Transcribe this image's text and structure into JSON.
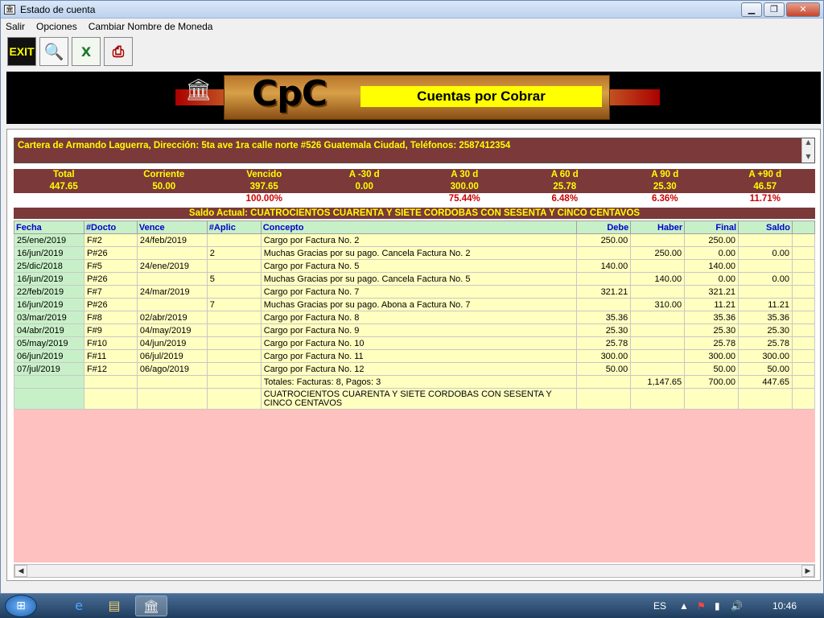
{
  "window": {
    "title": "Estado de cuenta"
  },
  "window_controls": {
    "minimize": "▁",
    "maximize": "❐",
    "close": "✕"
  },
  "menu": [
    "Salir",
    "Opciones",
    "Cambiar Nombre de Moneda"
  ],
  "toolbar": {
    "exit_label": "EXIT",
    "icons": [
      "exit-icon",
      "search-report-icon",
      "excel-icon",
      "print-icon"
    ]
  },
  "banner": {
    "logo": "CpC",
    "subtitle": "Cuentas por Cobrar"
  },
  "cartera": "Cartera de Armando Laguerra, Dirección: 5ta ave 1ra calle norte #526 Guatemala Ciudad, Teléfonos: 2587412354",
  "summary": {
    "headers": [
      "Total",
      "Corriente",
      "Vencido",
      "A -30 d",
      "A 30 d",
      "A 60 d",
      "A 90 d",
      "A +90 d"
    ],
    "values": [
      "447.65",
      "50.00",
      "397.65",
      "0.00",
      "300.00",
      "25.78",
      "25.30",
      "46.57"
    ],
    "percents": [
      "",
      "",
      "100.00%",
      "",
      "75.44%",
      "6.48%",
      "6.36%",
      "11.71%"
    ]
  },
  "saldo_actual": "Saldo Actual: CUATROCIENTOS CUARENTA Y SIETE CORDOBAS CON SESENTA Y CINCO CENTAVOS",
  "table": {
    "headers": [
      "Fecha",
      "#Docto",
      "Vence",
      "#Aplic",
      "Concepto",
      "Debe",
      "Haber",
      "Final",
      "Saldo"
    ],
    "rows": [
      [
        "25/ene/2019",
        "F#2",
        "24/feb/2019",
        "",
        "Cargo por Factura No. 2",
        "250.00",
        "",
        "250.00",
        ""
      ],
      [
        "16/jun/2019",
        "P#26",
        "",
        "2",
        "Muchas Gracias por su pago. Cancela Factura No. 2",
        "",
        "250.00",
        "0.00",
        "0.00"
      ],
      [
        "25/dic/2018",
        "F#5",
        "24/ene/2019",
        "",
        "Cargo por Factura No. 5",
        "140.00",
        "",
        "140.00",
        ""
      ],
      [
        "16/jun/2019",
        "P#26",
        "",
        "5",
        "Muchas Gracias por su pago. Cancela Factura No. 5",
        "",
        "140.00",
        "0.00",
        "0.00"
      ],
      [
        "22/feb/2019",
        "F#7",
        "24/mar/2019",
        "",
        "Cargo por Factura No. 7",
        "321.21",
        "",
        "321.21",
        ""
      ],
      [
        "16/jun/2019",
        "P#26",
        "",
        "7",
        "Muchas Gracias por su pago. Abona a Factura No. 7",
        "",
        "310.00",
        "11.21",
        "11.21"
      ],
      [
        "03/mar/2019",
        "F#8",
        "02/abr/2019",
        "",
        "Cargo por Factura No. 8",
        "35.36",
        "",
        "35.36",
        "35.36"
      ],
      [
        "04/abr/2019",
        "F#9",
        "04/may/2019",
        "",
        "Cargo por Factura No. 9",
        "25.30",
        "",
        "25.30",
        "25.30"
      ],
      [
        "05/may/2019",
        "F#10",
        "04/jun/2019",
        "",
        "Cargo por Factura No. 10",
        "25.78",
        "",
        "25.78",
        "25.78"
      ],
      [
        "06/jun/2019",
        "F#11",
        "06/jul/2019",
        "",
        "Cargo por Factura No. 11",
        "300.00",
        "",
        "300.00",
        "300.00"
      ],
      [
        "07/jul/2019",
        "F#12",
        "06/ago/2019",
        "",
        "Cargo por Factura No. 12",
        "50.00",
        "",
        "50.00",
        "50.00"
      ],
      [
        "",
        "",
        "",
        "",
        "Totales: Facturas: 8, Pagos: 3",
        "",
        "1,147.65",
        "700.00",
        "447.65"
      ],
      [
        "",
        "",
        "",
        "",
        "CUATROCIENTOS CUARENTA Y SIETE CORDOBAS CON SESENTA Y CINCO CENTAVOS",
        "",
        "",
        "",
        ""
      ]
    ]
  },
  "taskbar": {
    "items": [
      "start-orb",
      "internet-explorer-icon",
      "file-explorer-icon",
      "cpc-app-icon"
    ],
    "lang": "ES",
    "time": "10:46"
  }
}
